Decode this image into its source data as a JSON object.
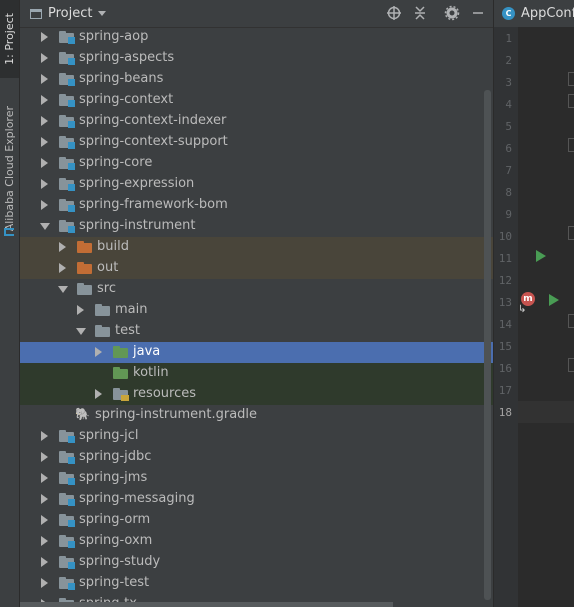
{
  "left_strip": {
    "project_tab": "1: Project",
    "alibaba_tab": "Alibaba Cloud Explorer"
  },
  "project_panel": {
    "title": "Project",
    "header_icons": [
      "crosshair-icon",
      "collapse-all-icon",
      "gear-icon",
      "minimize-icon"
    ]
  },
  "tree": [
    {
      "label": "spring-aop",
      "kind": "module",
      "level": 0,
      "arrow": "closed"
    },
    {
      "label": "spring-aspects",
      "kind": "module",
      "level": 0,
      "arrow": "closed"
    },
    {
      "label": "spring-beans",
      "kind": "module",
      "level": 0,
      "arrow": "closed"
    },
    {
      "label": "spring-context",
      "kind": "module",
      "level": 0,
      "arrow": "closed"
    },
    {
      "label": "spring-context-indexer",
      "kind": "module",
      "level": 0,
      "arrow": "closed"
    },
    {
      "label": "spring-context-support",
      "kind": "module",
      "level": 0,
      "arrow": "closed"
    },
    {
      "label": "spring-core",
      "kind": "module",
      "level": 0,
      "arrow": "closed"
    },
    {
      "label": "spring-expression",
      "kind": "module",
      "level": 0,
      "arrow": "closed"
    },
    {
      "label": "spring-framework-bom",
      "kind": "module",
      "level": 0,
      "arrow": "closed"
    },
    {
      "label": "spring-instrument",
      "kind": "module",
      "level": 0,
      "arrow": "open"
    },
    {
      "label": "build",
      "kind": "excluded",
      "level": 1,
      "arrow": "closed",
      "bg": "#49453a"
    },
    {
      "label": "out",
      "kind": "excluded",
      "level": 1,
      "arrow": "closed",
      "bg": "#49453a"
    },
    {
      "label": "src",
      "kind": "folder",
      "level": 1,
      "arrow": "open"
    },
    {
      "label": "main",
      "kind": "folder",
      "level": 2,
      "arrow": "closed"
    },
    {
      "label": "test",
      "kind": "folder",
      "level": 2,
      "arrow": "open"
    },
    {
      "label": "java",
      "kind": "test-source",
      "level": 3,
      "arrow": "closed",
      "bg": "#4b6eaf",
      "selected": true
    },
    {
      "label": "kotlin",
      "kind": "test-source",
      "level": 3,
      "arrow": "none",
      "bg": "#2f3a2c"
    },
    {
      "label": "resources",
      "kind": "resources",
      "level": 3,
      "arrow": "closed",
      "bg": "#2f3a2c"
    },
    {
      "label": "spring-instrument.gradle",
      "kind": "gradle",
      "level": 1,
      "arrow": "none"
    },
    {
      "label": "spring-jcl",
      "kind": "module",
      "level": 0,
      "arrow": "closed"
    },
    {
      "label": "spring-jdbc",
      "kind": "module",
      "level": 0,
      "arrow": "closed"
    },
    {
      "label": "spring-jms",
      "kind": "module",
      "level": 0,
      "arrow": "closed"
    },
    {
      "label": "spring-messaging",
      "kind": "module",
      "level": 0,
      "arrow": "closed"
    },
    {
      "label": "spring-orm",
      "kind": "module",
      "level": 0,
      "arrow": "closed"
    },
    {
      "label": "spring-oxm",
      "kind": "module",
      "level": 0,
      "arrow": "closed"
    },
    {
      "label": "spring-study",
      "kind": "module",
      "level": 0,
      "arrow": "closed"
    },
    {
      "label": "spring-test",
      "kind": "module",
      "level": 0,
      "arrow": "closed"
    },
    {
      "label": "spring-tx",
      "kind": "module",
      "level": 0,
      "arrow": "closed"
    }
  ],
  "editor": {
    "tab_label": "AppConfi",
    "tab_icon": "C",
    "line_numbers": [
      "1",
      "2",
      "3",
      "4",
      "5",
      "6",
      "7",
      "8",
      "9",
      "10",
      "11",
      "12",
      "13",
      "14",
      "15",
      "16",
      "17",
      "18"
    ],
    "current_line": "18",
    "bean_icon": "m"
  },
  "colors": {
    "panel_bg": "#3c3f41",
    "editor_bg": "#2b2b2b",
    "selection": "#4b6eaf",
    "excluded_folder": "#c26d35",
    "module_folder": "#87939a",
    "test_folder": "#629755",
    "run_green": "#499c54"
  }
}
